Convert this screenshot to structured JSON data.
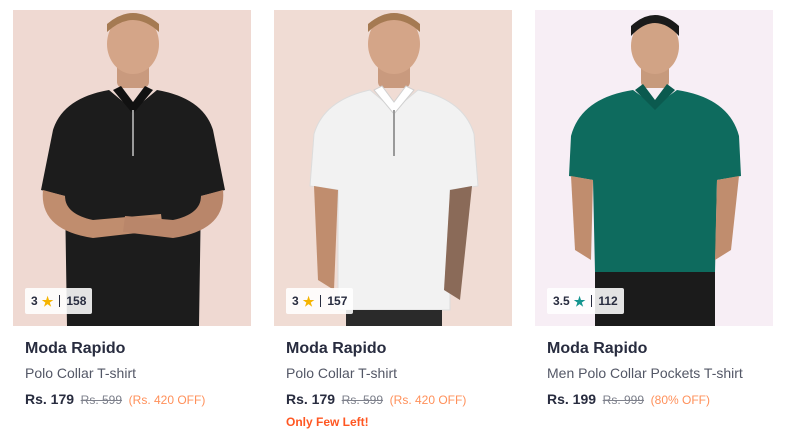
{
  "products": [
    {
      "rating": "3",
      "star_color": "#f5b400",
      "rating_count": "158",
      "brand": "Moda Rapido",
      "title": "Polo Collar T-shirt",
      "price": "Rs. 179",
      "mrp": "Rs. 599",
      "discount": "(Rs. 420 OFF)",
      "stock_note": "",
      "shirt_color": "#1c1c1c",
      "bg_color": "#efd9d2"
    },
    {
      "rating": "3",
      "star_color": "#f5b400",
      "rating_count": "157",
      "brand": "Moda Rapido",
      "title": "Polo Collar T-shirt",
      "price": "Rs. 179",
      "mrp": "Rs. 599",
      "discount": "(Rs. 420 OFF)",
      "stock_note": "Only Few Left!",
      "shirt_color": "#f2f2f2",
      "bg_color": "#f0dcd4"
    },
    {
      "rating": "3.5",
      "star_color": "#14958f",
      "rating_count": "112",
      "brand": "Moda Rapido",
      "title": "Men Polo Collar Pockets T-shirt",
      "price": "Rs. 199",
      "mrp": "Rs. 999",
      "discount": "(80% OFF)",
      "stock_note": "",
      "shirt_color": "#0e6b5e",
      "bg_color": "#f7eef5"
    }
  ]
}
